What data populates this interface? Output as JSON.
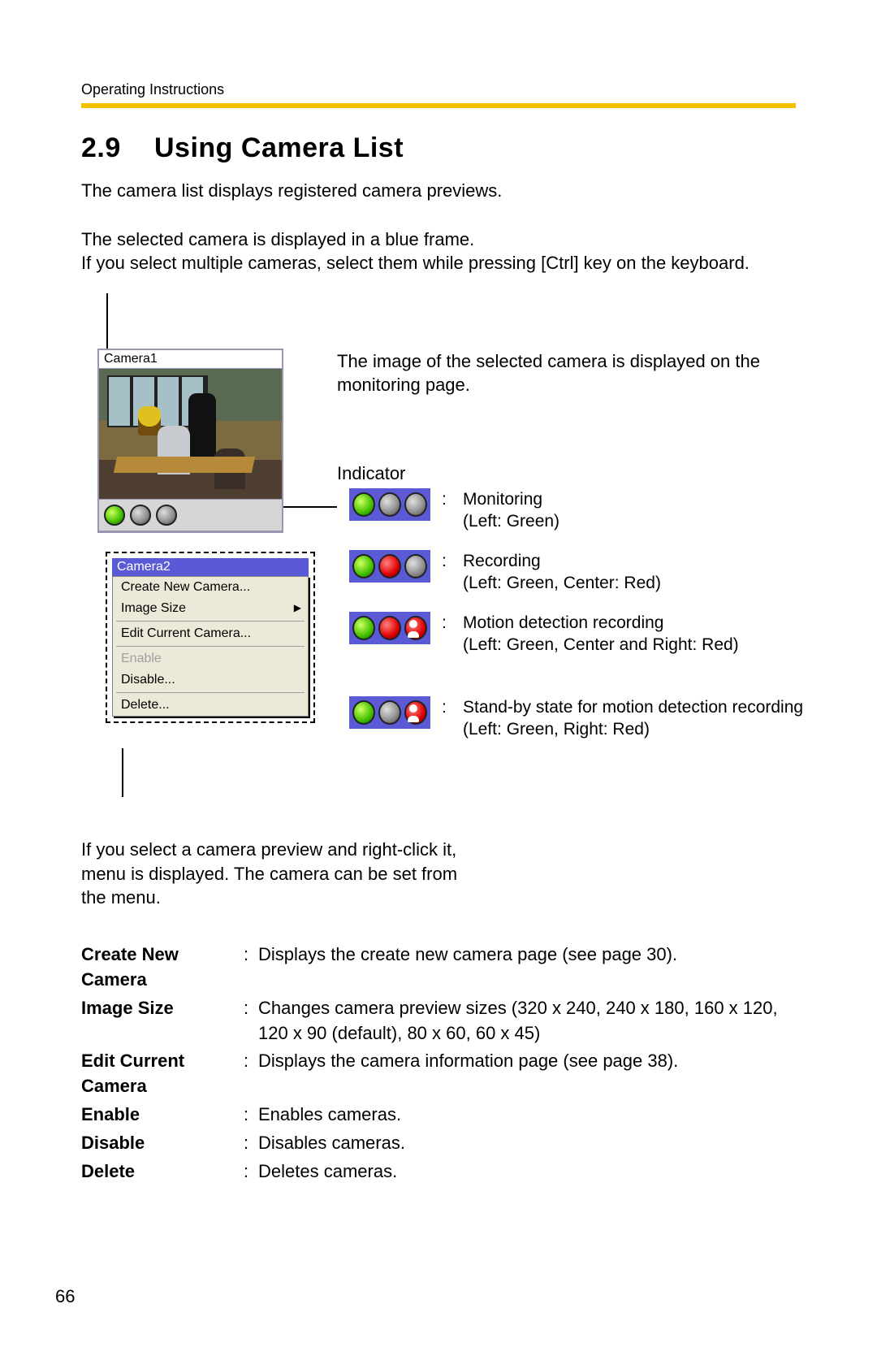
{
  "running_head": "Operating Instructions",
  "section_number": "2.9",
  "section_title": "Using Camera List",
  "intro": "The camera list displays registered camera previews.",
  "para2_line1": "The selected camera is displayed in a blue frame.",
  "para2_line2": "If you select multiple cameras, select them while pressing [Ctrl] key on the keyboard.",
  "fig": {
    "camera1_label": "Camera1",
    "camera2_label": "Camera2",
    "displayed_text": "The image of the selected camera is displayed on the monitoring page.",
    "indicator_label": "Indicator",
    "indicators": [
      {
        "name": "Monitoring",
        "detail": "(Left: Green)"
      },
      {
        "name": "Recording",
        "detail": "(Left: Green, Center: Red)"
      },
      {
        "name": "Motion detection recording",
        "detail": "(Left: Green, Center and Right: Red)"
      },
      {
        "name": "Stand-by state for motion detection recording",
        "detail": "(Left: Green, Right: Red)"
      }
    ],
    "context_menu": {
      "create": "Create New Camera...",
      "image_size": "Image Size",
      "edit": "Edit Current Camera...",
      "enable": "Enable",
      "disable": "Disable...",
      "delete": "Delete..."
    }
  },
  "rightclick_text_l1": "If you select a camera preview and right-click it,",
  "rightclick_text_l2": "menu is displayed. The camera can be set from",
  "rightclick_text_l3": "the menu.",
  "definitions": [
    {
      "term": "Create New Camera",
      "desc": "Displays the create new camera page (see page 30)."
    },
    {
      "term": "Image Size",
      "desc": "Changes camera preview sizes (320 x 240, 240 x 180, 160 x 120, 120 x 90 (default), 80 x 60, 60 x 45)"
    },
    {
      "term": "Edit Current Camera",
      "desc": "Displays the camera information page (see page 38)."
    },
    {
      "term": "Enable",
      "desc": "Enables cameras."
    },
    {
      "term": "Disable",
      "desc": "Disables cameras."
    },
    {
      "term": "Delete",
      "desc": "Deletes cameras."
    }
  ],
  "page_number": "66"
}
